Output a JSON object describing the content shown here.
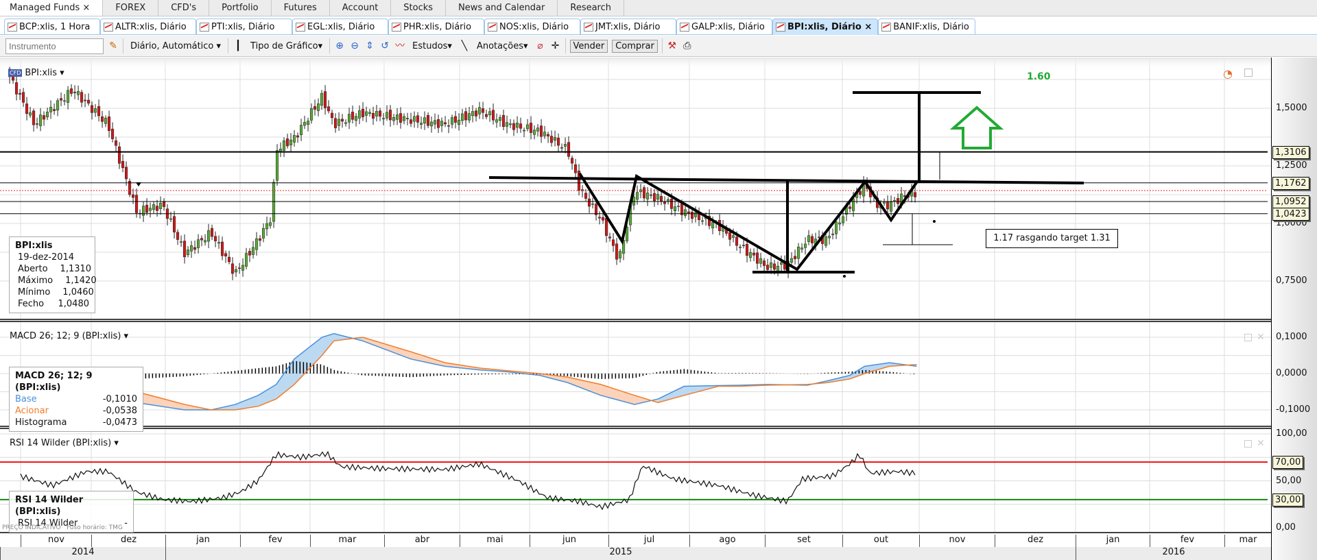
{
  "top_tabs": [
    {
      "label": "Managed Funds ×"
    },
    {
      "label": "FOREX"
    },
    {
      "label": "CFD's"
    },
    {
      "label": "Portfolio"
    },
    {
      "label": "Futures"
    },
    {
      "label": "Account"
    },
    {
      "label": "Stocks"
    },
    {
      "label": "News and Calendar"
    },
    {
      "label": "Research"
    }
  ],
  "chart_tabs": [
    {
      "label": "BCP:xlis, 1 Hora"
    },
    {
      "label": "ALTR:xlis, Diário"
    },
    {
      "label": "PTI:xlis, Diário"
    },
    {
      "label": "EGL:xlis, Diário"
    },
    {
      "label": "PHR:xlis, Diário"
    },
    {
      "label": "NOS:xlis, Diário"
    },
    {
      "label": "JMT:xlis, Diário"
    },
    {
      "label": "GALP:xlis, Diário"
    },
    {
      "label": "BPI:xlis, Diário ×"
    },
    {
      "label": "BANIF:xlis, Diário"
    }
  ],
  "toolbar": {
    "instrument_placeholder": "Instrumento",
    "period": "Diário, Automático ▾",
    "chart_type": "Tipo de Gráfico▾",
    "studies": "Estudos▾",
    "annotations": "Anotações▾",
    "sell": "Vender",
    "buy": "Comprar"
  },
  "price_panel": {
    "title": "BPI:xlis ▾",
    "ticks": [
      "1,5000",
      "1,2500",
      "1,0000",
      "0,7500"
    ],
    "tags": [
      "1,3106",
      "1,1762",
      "1,0952",
      "1,0423"
    ],
    "note_target": "1.60",
    "note_box": "1.17 rasgando target 1.31",
    "info": {
      "symbol": "BPI:xlis",
      "date": "19-dez-2014",
      "rows": [
        {
          "k": "Aberto",
          "v": "1,1310"
        },
        {
          "k": "Máximo",
          "v": "1,1420"
        },
        {
          "k": "Mínimo",
          "v": "1,0460"
        },
        {
          "k": "Fecho",
          "v": "1,0480"
        }
      ]
    }
  },
  "macd_panel": {
    "title": "MACD 26; 12; 9 (BPI:xlis) ▾",
    "ticks": [
      "0,1000",
      "0,0000",
      "-0,1000"
    ],
    "info": {
      "title": "MACD 26; 12; 9 (BPI:xlis)",
      "rows": [
        {
          "k": "Base",
          "v": "-0,1010"
        },
        {
          "k": "Acionar",
          "v": "-0,0538"
        },
        {
          "k": "Histograma",
          "v": "-0,0473"
        }
      ]
    }
  },
  "rsi_panel": {
    "title": "RSI 14 Wilder (BPI:xlis) ▾",
    "ticks": [
      "100,00",
      "50,00",
      "0,00"
    ],
    "tags": [
      "70,00",
      "30,00"
    ],
    "info": {
      "title": "RSI 14 Wilder (BPI:xlis)",
      "rows": [
        {
          "k": "RSI 14 Wilder",
          "v": "-"
        }
      ]
    }
  },
  "footer_note": "PREÇO INDICATIVO   Fuso horário: TMG",
  "time_axis": {
    "months": [
      "nov",
      "dez",
      "jan",
      "fev",
      "mar",
      "abr",
      "mai",
      "jun",
      "jul",
      "ago",
      "set",
      "out",
      "nov",
      "dez",
      "jan",
      "fev",
      "mar"
    ],
    "years": [
      "2014",
      "2015",
      "2016"
    ]
  },
  "colors": {
    "up": "#5aa83a",
    "down": "#cc1a1a",
    "base": "#4a90d9",
    "signal": "#f07c2a",
    "rsi_high": "#ee1111",
    "rsi_low": "#118811",
    "target": "#22aa33"
  },
  "chart_data": [
    {
      "type": "candlestick",
      "title": "BPI:xlis",
      "ylim": [
        0.7,
        1.7
      ],
      "x": [
        "2014-10-26",
        "2014-11-07",
        "2014-11-24",
        "2014-12-08",
        "2014-12-20",
        "2014-12-31",
        "2015-01-09",
        "2015-01-20",
        "2015-01-30",
        "2015-02-09",
        "2015-02-15",
        "2015-02-17",
        "2015-02-25",
        "2015-03-06",
        "2015-03-11",
        "2015-03-23",
        "2015-04-12",
        "2015-04-26",
        "2015-05-10",
        "2015-05-22",
        "2015-06-05",
        "2015-06-16",
        "2015-06-21",
        "2015-06-29",
        "2015-07-05",
        "2015-07-11",
        "2015-07-20",
        "2015-07-30",
        "2015-08-13",
        "2015-08-22",
        "2015-09-02",
        "2015-09-10",
        "2015-09-18",
        "2015-09-26",
        "2015-10-04",
        "2015-10-10",
        "2015-10-15",
        "2015-10-20",
        "2015-10-26",
        "2015-10-31"
      ],
      "close": [
        1.66,
        1.43,
        1.58,
        1.43,
        1.05,
        1.08,
        0.87,
        0.96,
        0.78,
        0.93,
        1.03,
        1.32,
        1.37,
        1.55,
        1.43,
        1.48,
        1.45,
        1.43,
        1.49,
        1.43,
        1.4,
        1.32,
        1.14,
        1.02,
        0.84,
        1.14,
        1.11,
        1.05,
        0.99,
        0.9,
        0.81,
        0.82,
        0.93,
        0.93,
        1.08,
        1.17,
        1.08,
        1.08,
        1.12,
        1.13
      ],
      "levels": [
        1.3106,
        1.1762,
        1.0952,
        1.0423
      ]
    },
    {
      "type": "line",
      "title": "MACD 26; 12; 9",
      "ylim": [
        -0.14,
        0.14
      ],
      "x": [
        "2014-12-08",
        "2014-12-20",
        "2015-01-09",
        "2015-01-20",
        "2015-01-30",
        "2015-02-09",
        "2015-02-17",
        "2015-02-25",
        "2015-03-06",
        "2015-03-11",
        "2015-03-23",
        "2015-04-12",
        "2015-04-26",
        "2015-05-10",
        "2015-05-22",
        "2015-06-05",
        "2015-06-16",
        "2015-06-29",
        "2015-07-11",
        "2015-07-20",
        "2015-07-30",
        "2015-08-13",
        "2015-08-22",
        "2015-09-02",
        "2015-09-18",
        "2015-09-26",
        "2015-10-04",
        "2015-10-10",
        "2015-10-20",
        "2015-10-31"
      ],
      "series": [
        {
          "name": "Base",
          "values": [
            -0.03,
            -0.08,
            -0.1,
            -0.1,
            -0.085,
            -0.06,
            -0.03,
            0.04,
            0.1,
            0.11,
            0.09,
            0.04,
            0.02,
            0.01,
            0.005,
            -0.005,
            -0.025,
            -0.06,
            -0.085,
            -0.07,
            -0.035,
            -0.033,
            -0.032,
            -0.03,
            -0.032,
            -0.02,
            -0.005,
            0.02,
            0.03,
            0.02
          ]
        },
        {
          "name": "Acionar",
          "values": [
            -0.02,
            -0.05,
            -0.085,
            -0.1,
            -0.1,
            -0.09,
            -0.07,
            -0.03,
            0.05,
            0.09,
            0.1,
            0.06,
            0.03,
            0.015,
            0.008,
            0.0,
            -0.01,
            -0.03,
            -0.06,
            -0.08,
            -0.06,
            -0.035,
            -0.035,
            -0.032,
            -0.03,
            -0.025,
            -0.015,
            0.0,
            0.02,
            0.025
          ]
        }
      ]
    },
    {
      "type": "line",
      "title": "RSI 14 Wilder",
      "ylim": [
        0,
        100
      ],
      "levels": [
        70,
        30
      ],
      "x": [
        "2014-11-01",
        "2014-11-15",
        "2014-11-30",
        "2014-12-08",
        "2014-12-20",
        "2014-12-31",
        "2015-01-12",
        "2015-01-25",
        "2015-02-01",
        "2015-02-09",
        "2015-02-17",
        "2015-02-28",
        "2015-03-08",
        "2015-03-14",
        "2015-04-01",
        "2015-04-26",
        "2015-05-10",
        "2015-05-27",
        "2015-06-08",
        "2015-06-21",
        "2015-06-29",
        "2015-07-09",
        "2015-07-14",
        "2015-07-26",
        "2015-08-13",
        "2015-08-27",
        "2015-09-10",
        "2015-09-16",
        "2015-09-28",
        "2015-10-04",
        "2015-10-08",
        "2015-10-12",
        "2015-10-23",
        "2015-10-31"
      ],
      "values": [
        55,
        45,
        60,
        60,
        38,
        30,
        28,
        32,
        38,
        50,
        78,
        75,
        79,
        65,
        63,
        62,
        68,
        50,
        32,
        28,
        22,
        30,
        66,
        52,
        45,
        35,
        28,
        52,
        55,
        68,
        78,
        58,
        60,
        58
      ]
    }
  ]
}
